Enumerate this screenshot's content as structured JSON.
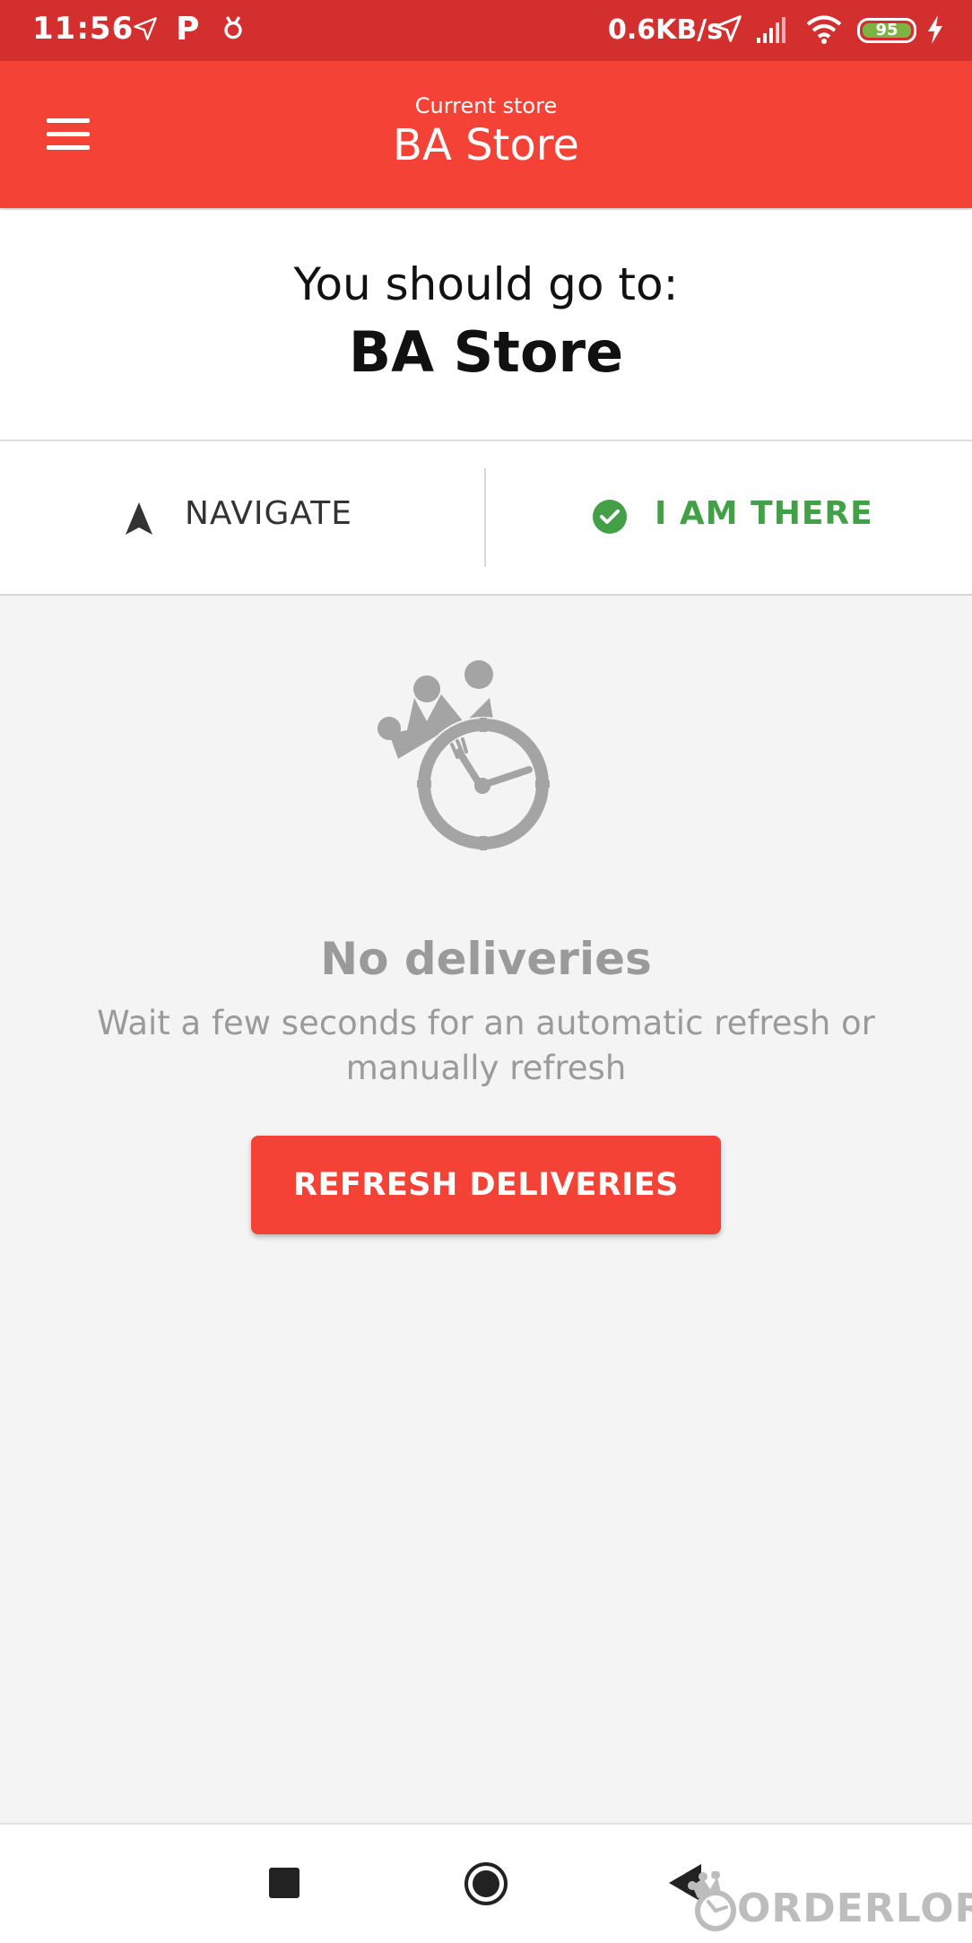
{
  "status_bar": {
    "time": "11:56",
    "p_icon": "P",
    "network_speed": "0.6KB/s",
    "battery_level": "95",
    "icons": [
      "navigation-arrow-icon",
      "parking-icon",
      "bug-icon",
      "location-icon",
      "signal-icon",
      "wifi-icon",
      "battery-icon",
      "charging-icon"
    ]
  },
  "app_bar": {
    "subtitle": "Current store",
    "title": "BA Store",
    "menu_icon": "hamburger-menu-icon"
  },
  "destination": {
    "label": "You should go to:",
    "store": "BA Store"
  },
  "actions": {
    "navigate_label": "NAVIGATE",
    "navigate_icon": "navigation-arrow-icon",
    "iamthere_label": "I AM THERE",
    "iamthere_icon": "check-circle-icon"
  },
  "empty_state": {
    "logo_icon": "crown-clock-icon",
    "title": "No deliveries",
    "message": "Wait a few seconds for an automatic refresh or manually refresh",
    "button_label": "REFRESH DELIVERIES"
  },
  "nav_bar": {
    "icons": [
      "recents-square-icon",
      "home-circle-icon",
      "back-triangle-icon"
    ]
  },
  "watermark": {
    "text": "ORDERLORD"
  },
  "colors": {
    "status_bar": "#d32f2f",
    "app_bar": "#f44336",
    "accent_green": "#43a047",
    "muted_text": "#9a9a9a"
  }
}
